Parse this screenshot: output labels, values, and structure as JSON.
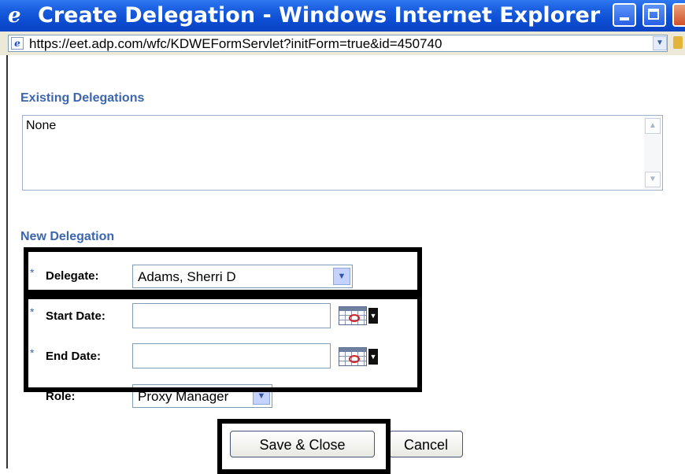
{
  "window": {
    "title": "Create Delegation - Windows Internet Explorer",
    "url": "https://eet.adp.com/wfc/KDWEFormServlet?initForm=true&id=450740"
  },
  "existing": {
    "label": "Existing Delegations",
    "value": "None"
  },
  "new_delegation": {
    "label": "New Delegation",
    "required_marker": "*",
    "delegate": {
      "label": "Delegate:",
      "value": "Adams, Sherri D"
    },
    "start_date": {
      "label": "Start Date:",
      "value": ""
    },
    "end_date": {
      "label": "End Date:",
      "value": ""
    },
    "role": {
      "label": "Role:",
      "value": "Proxy Manager"
    }
  },
  "buttons": {
    "save_close": "Save & Close",
    "cancel": "Cancel"
  },
  "colors": {
    "title_bar": "#0b4bd0",
    "section_label": "#3c66ae",
    "highlight_border": "#000000"
  }
}
